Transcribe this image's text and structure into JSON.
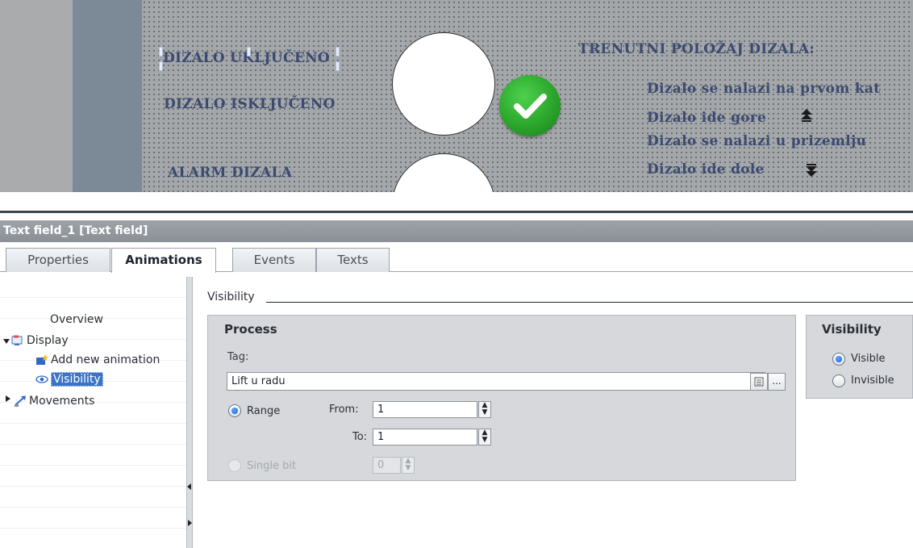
{
  "hmi": {
    "labels": {
      "lift_on": "DIZALO UKLJUČENO",
      "lift_off": "DIZALO ISKLJUČENO",
      "lift_alarm": "ALARM DIZALA",
      "position_title": "TRENUTNI POLOŽAJ DIZALA:",
      "first_floor": "Dizalo se nalazi na prvom kat",
      "going_up": "Dizalo ide gore",
      "ground_floor": "Dizalo se nalazi u prizemlju",
      "going_down": "Dizalo ide dole"
    },
    "icons": [
      "check-circle-icon",
      "arrow-up-icon",
      "arrow-down-icon"
    ],
    "colors": {
      "label_text": "#3b4a70",
      "check_green": "#2ba62b",
      "background": "#a4a7aa"
    }
  },
  "inspector": {
    "title": "Text field_1 [Text field]",
    "tabs": [
      "Properties",
      "Animations",
      "Events",
      "Texts"
    ],
    "active_tab": "Animations",
    "tree": {
      "overview": "Overview",
      "display": "Display",
      "add_new_animation": "Add new animation",
      "visibility": "Visibility",
      "movements": "Movements"
    },
    "section_heading": "Visibility",
    "process": {
      "title": "Process",
      "tag_label": "Tag:",
      "tag_value": "Lift u radu",
      "range_label": "Range",
      "from_label": "From:",
      "from_value": "1",
      "to_label": "To:",
      "to_value": "1",
      "single_bit_label": "Single bit",
      "single_bit_value": "0",
      "browse_button": "..."
    },
    "visibility": {
      "title": "Visibility",
      "visible_label": "Visible",
      "invisible_label": "Invisible",
      "selected": "Visible"
    },
    "colors": {
      "selection": "#3b74c4",
      "title_bar": "#9ea3a8"
    }
  }
}
